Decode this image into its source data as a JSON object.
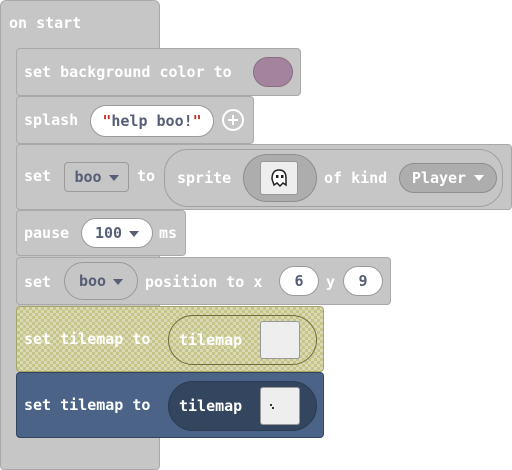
{
  "colors": {
    "block_gray": "#c6c6c6",
    "background_swatch": "#a4839f",
    "tilemap_dark": "#4a6387",
    "tilemap_checker": "#c5c58a",
    "field_text": "#575e75"
  },
  "on_start": {
    "label": "on start"
  },
  "set_background": {
    "label": "set background color to",
    "color_name": "background_swatch"
  },
  "splash": {
    "label": "splash",
    "message": "help boo!",
    "add_icon": "plus-circle-icon"
  },
  "set_sprite": {
    "set_label": "set",
    "variable": "boo",
    "to_label": "to",
    "sprite_label": "sprite",
    "of_kind_label": "of kind",
    "kind": "Player",
    "sprite_icon": "ghost-sprite-icon"
  },
  "pause": {
    "label": "pause",
    "value": "100",
    "unit": "ms"
  },
  "set_position": {
    "set_label": "set",
    "variable": "boo",
    "position_label": "position to x",
    "x_value": "6",
    "y_label": "y",
    "y_value": "9"
  },
  "set_tilemap_1": {
    "label": "set tilemap to",
    "tilemap_label": "tilemap"
  },
  "set_tilemap_2": {
    "label": "set tilemap to",
    "tilemap_label": "tilemap"
  }
}
